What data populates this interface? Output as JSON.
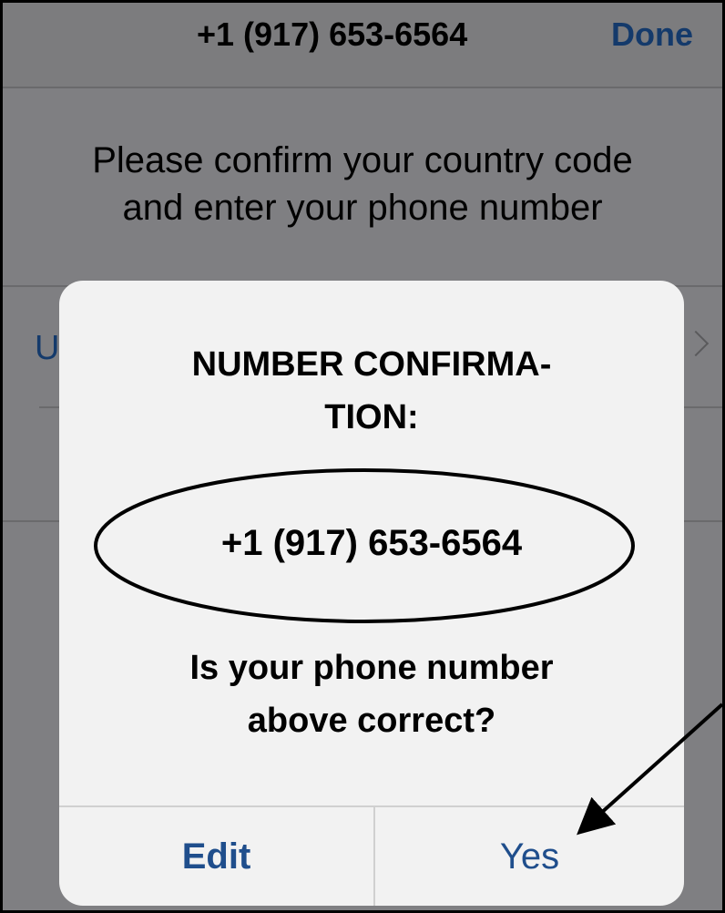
{
  "nav": {
    "title": "+1 (917) 653-6564",
    "done_label": "Done"
  },
  "instructions": "Please confirm your country code\nand enter your phone number",
  "country_row": {
    "label_partial": "U"
  },
  "alert": {
    "title": "NUMBER CONFIRMA-\nTION:",
    "phone_number": "+1 (917) 653-6564",
    "question": "Is your phone number\nabove correct?",
    "edit_label": "Edit",
    "yes_label": "Yes"
  },
  "colors": {
    "dim_background": "#7f7f82",
    "alert_background": "#f2f2f2",
    "link_blue": "#1f4e8c",
    "done_blue": "#143a6b"
  },
  "icons": {
    "row_disclosure": "chevron-right-icon",
    "highlight": "number-highlight-ellipse",
    "pointer": "arrow-to-yes-button"
  }
}
